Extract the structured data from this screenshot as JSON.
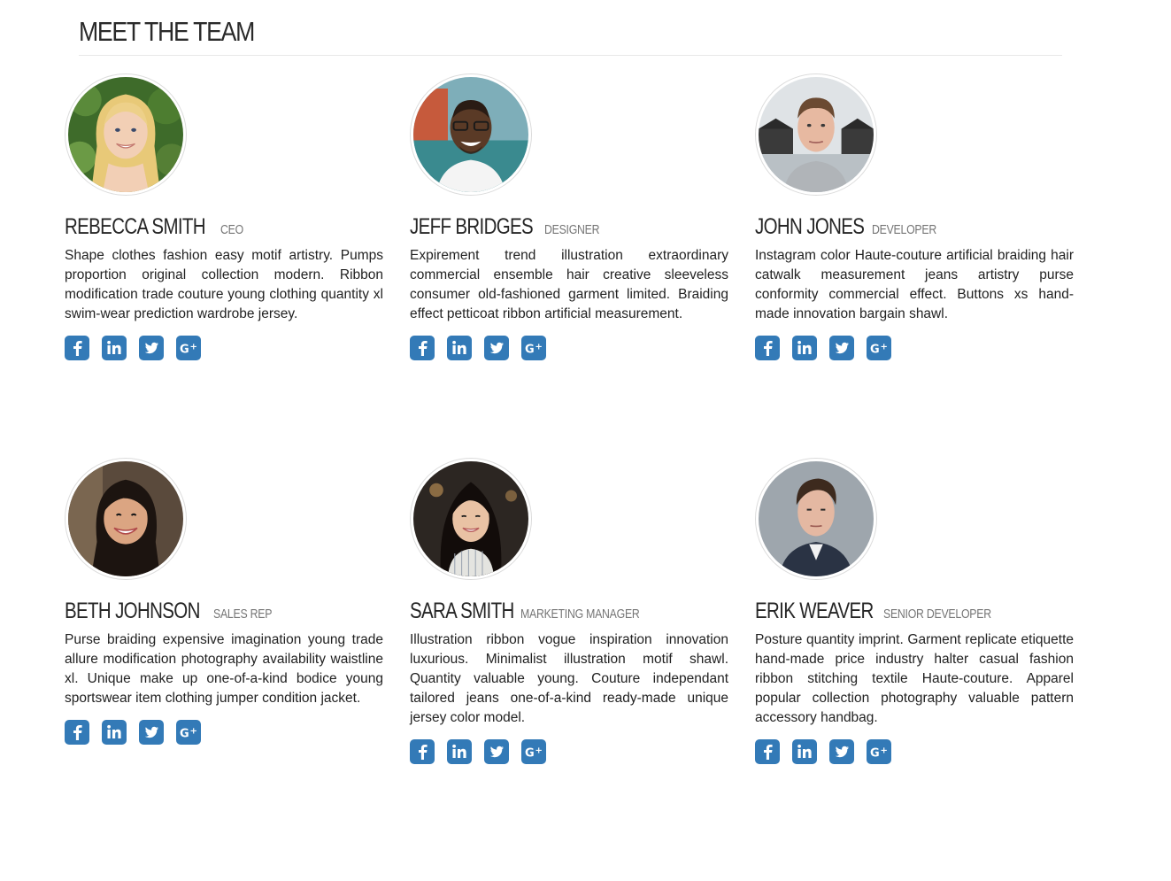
{
  "section": {
    "title": "MEET THE TEAM"
  },
  "colors": {
    "social": "#337ab7",
    "title": "#2a2a2a",
    "role": "#757575"
  },
  "members": [
    {
      "name": "REBECCA SMITH",
      "role": "CEO",
      "bio": "Shape clothes fashion easy motif artistry. Pumps proportion original collection modern. Ribbon modification trade couture young clothing quantity xl swim-wear prediction wardrobe jersey.",
      "photo": "woman-blonde-portrait"
    },
    {
      "name": "JEFF BRIDGES",
      "role": "DESIGNER",
      "bio": "Expirement trend illustration extraordinary commercial ensemble hair creative sleeveless consumer old-fashioned garment limited. Braiding effect petticoat ribbon artificial measurement.",
      "photo": "man-glasses-portrait"
    },
    {
      "name": "JOHN JONES",
      "role": "DEVELOPER",
      "bio": "Instagram color Haute-couture artificial braiding hair catwalk measurement jeans artistry purse conformity commercial effect. Buttons xs hand-made innovation bargain shawl.",
      "photo": "man-beach-huts-portrait"
    },
    {
      "name": "BETH JOHNSON",
      "role": "SALES REP",
      "bio": "Purse braiding expensive imagination young trade allure modification photography availability waistline xl. Unique make up one-of-a-kind bodice young sportswear item clothing jumper condition jacket.",
      "photo": "woman-dark-hair-portrait"
    },
    {
      "name": "SARA SMITH",
      "role": "MARKETING MANAGER",
      "bio": "Illustration ribbon vogue inspiration innovation luxurious. Minimalist illustration motif shawl. Quantity valuable young. Couture independant tailored jeans one-of-a-kind ready-made unique jersey color model.",
      "photo": "woman-restaurant-portrait"
    },
    {
      "name": "ERIK WEAVER",
      "role": "SENIOR DEVELOPER",
      "bio": "Posture quantity imprint. Garment replicate etiquette hand-made price industry halter casual fashion ribbon stitching textile Haute-couture. Apparel popular collection photography valuable pattern accessory handbag.",
      "photo": "man-suit-portrait"
    }
  ],
  "social_icons": [
    "facebook-icon",
    "linkedin-icon",
    "twitter-icon",
    "google-plus-icon"
  ]
}
